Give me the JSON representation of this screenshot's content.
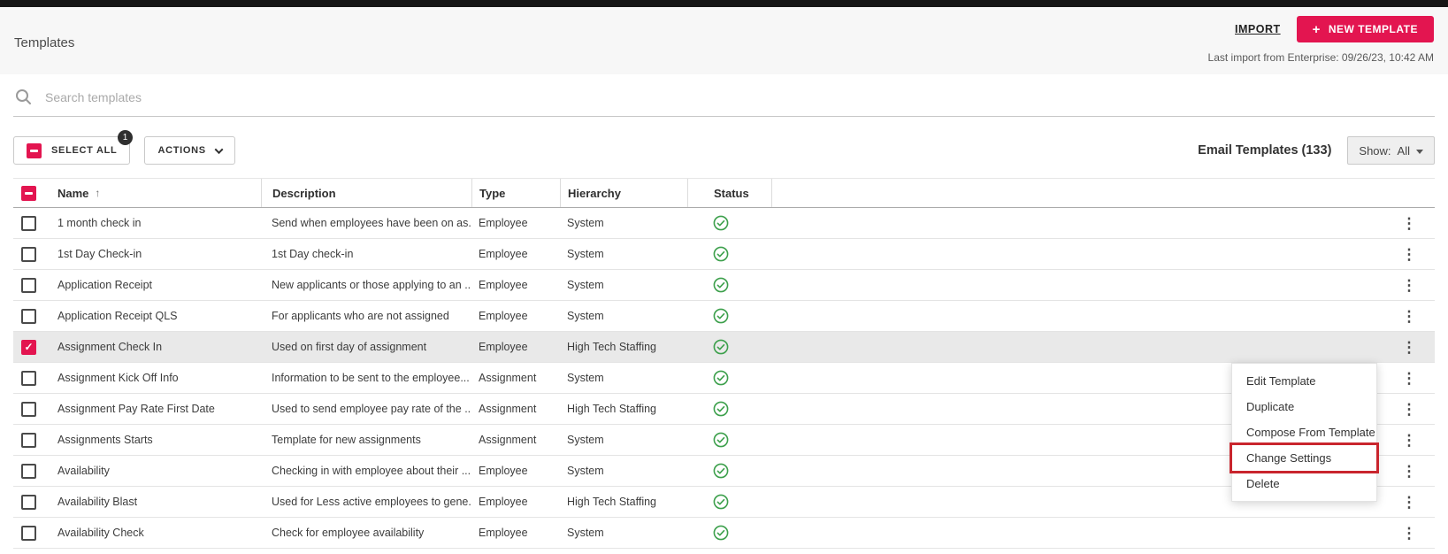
{
  "page": {
    "title": "Templates",
    "import_label": "IMPORT",
    "new_template_label": "NEW TEMPLATE",
    "last_import": "Last import from Enterprise: 09/26/23, 10:42 AM"
  },
  "search": {
    "placeholder": "Search templates"
  },
  "toolbar": {
    "select_all_label": "SELECT ALL",
    "select_all_badge": "1",
    "actions_label": "ACTIONS",
    "count_label": "Email Templates (133)",
    "show_label": "Show:",
    "show_value": "All"
  },
  "table": {
    "columns": [
      "Name",
      "Description",
      "Type",
      "Hierarchy",
      "Status"
    ],
    "sort_column": "Name",
    "sort_direction": "asc",
    "rows": [
      {
        "name": "1 month check in",
        "description": "Send when employees have been on as...",
        "type": "Employee",
        "hierarchy": "System",
        "status": "active",
        "selected": false
      },
      {
        "name": "1st Day Check-in",
        "description": "1st Day check-in",
        "type": "Employee",
        "hierarchy": "System",
        "status": "active",
        "selected": false
      },
      {
        "name": "Application Receipt",
        "description": "New applicants or those applying to an ...",
        "type": "Employee",
        "hierarchy": "System",
        "status": "active",
        "selected": false
      },
      {
        "name": "Application Receipt QLS",
        "description": "For applicants who are not assigned",
        "type": "Employee",
        "hierarchy": "System",
        "status": "active",
        "selected": false
      },
      {
        "name": "Assignment Check In",
        "description": "Used on first day of assignment",
        "type": "Employee",
        "hierarchy": "High Tech Staffing",
        "status": "active",
        "selected": true
      },
      {
        "name": "Assignment Kick Off Info",
        "description": "Information to be sent to the employee...",
        "type": "Assignment",
        "hierarchy": "System",
        "status": "active",
        "selected": false
      },
      {
        "name": "Assignment Pay Rate First Date",
        "description": "Used to send employee pay rate of the ...",
        "type": "Assignment",
        "hierarchy": "High Tech Staffing",
        "status": "active",
        "selected": false
      },
      {
        "name": "Assignments Starts",
        "description": "Template for new assignments",
        "type": "Assignment",
        "hierarchy": "System",
        "status": "active",
        "selected": false
      },
      {
        "name": "Availability",
        "description": "Checking in with employee about their ...",
        "type": "Employee",
        "hierarchy": "System",
        "status": "active",
        "selected": false
      },
      {
        "name": "Availability Blast",
        "description": "Used for Less active employees to gene...",
        "type": "Employee",
        "hierarchy": "High Tech Staffing",
        "status": "active",
        "selected": false
      },
      {
        "name": "Availability Check",
        "description": "Check for employee availability",
        "type": "Employee",
        "hierarchy": "System",
        "status": "active",
        "selected": false
      }
    ]
  },
  "context_menu": {
    "items": [
      "Edit Template",
      "Duplicate",
      "Compose From Template",
      "Change Settings",
      "Delete"
    ],
    "highlighted": "Change Settings"
  },
  "colors": {
    "accent_pink": "#e31550",
    "status_green": "#3da04c",
    "annotation_red": "#c9252d",
    "selected_row_bg": "#e9e9e9"
  }
}
